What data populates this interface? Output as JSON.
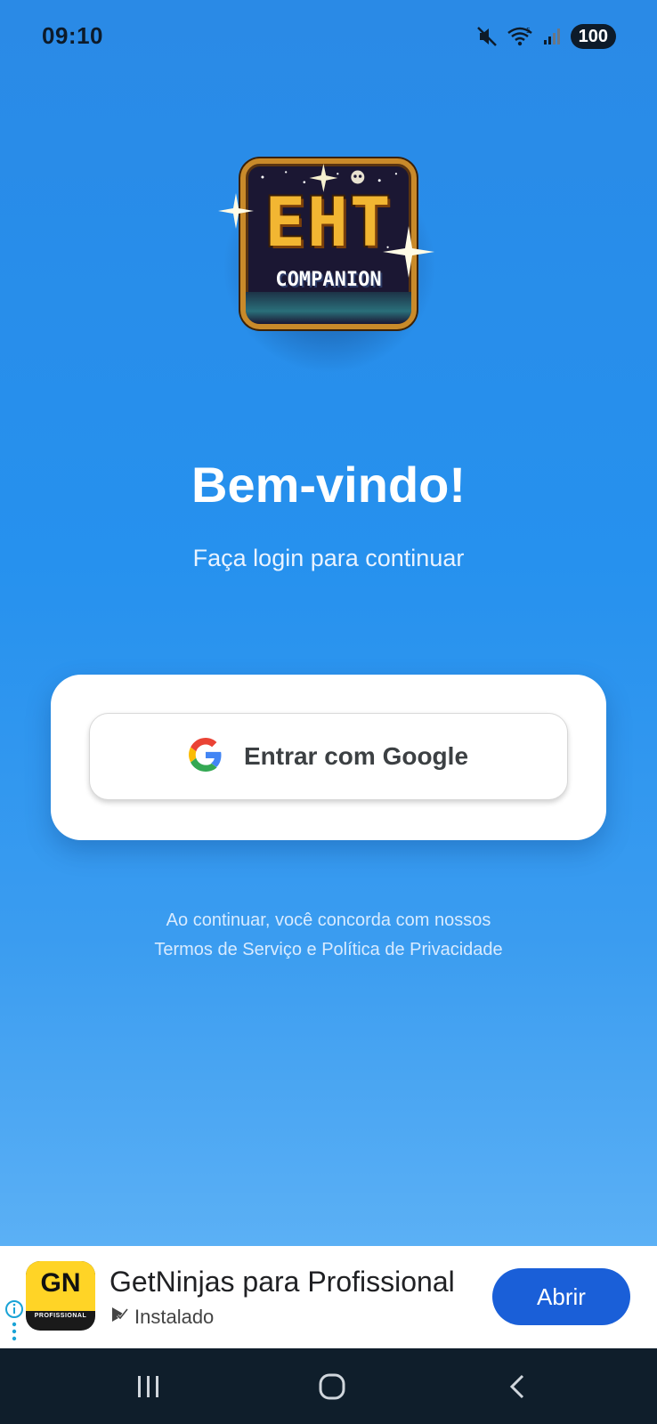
{
  "status_bar": {
    "time": "09:10",
    "battery": "100",
    "icons": [
      "mute-icon",
      "wifi-icon",
      "signal-icon"
    ]
  },
  "logo": {
    "title": "EHT",
    "subtitle": "COMPANION"
  },
  "welcome": {
    "title": "Bem-vindo!",
    "subtitle": "Faça login para continuar"
  },
  "login": {
    "google_button_label": "Entrar com Google",
    "icon": "google-g-icon"
  },
  "terms": {
    "line1": "Ao continuar, você concorda com nossos",
    "line2": "Termos de Serviço e Política de Privacidade"
  },
  "ad": {
    "app_icon_text": "GN",
    "app_icon_subtext": "PROFISSIONAL",
    "title": "GetNinjas para Profissional",
    "status": "Instalado",
    "button_label": "Abrir",
    "colors": {
      "button": "#1a5fd8",
      "icon_yellow": "#ffd426"
    }
  },
  "nav_bar": {
    "buttons": [
      "recents-icon",
      "home-icon",
      "back-icon"
    ]
  },
  "colors": {
    "background_top": "#2a8ae6",
    "background_bottom": "#5bb0f5",
    "card": "#ffffff"
  }
}
